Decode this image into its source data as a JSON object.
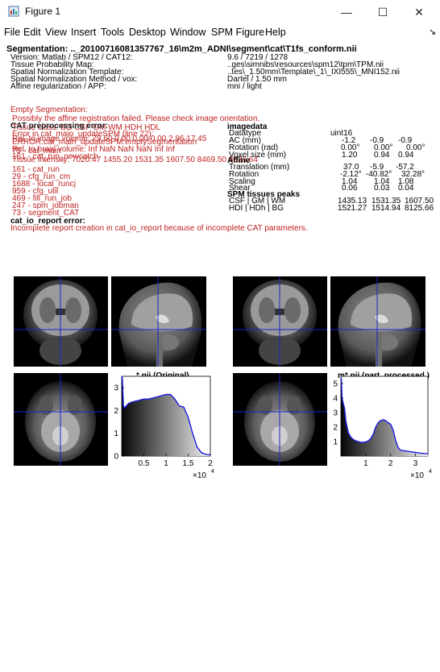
{
  "window": {
    "title": "Figure 1",
    "controls": {
      "minimize": "—",
      "maximize": "☐",
      "close": "✕"
    }
  },
  "menu": [
    "File",
    "Edit",
    "View",
    "Insert",
    "Tools",
    "Desktop",
    "Window",
    "SPM Figure",
    "Help"
  ],
  "menu_arrow": "↘",
  "report": {
    "segmentation": "Segmentation: .._20100716081357767_16\\m2m_ADNI\\segment\\cat\\T1fs_conform.nii",
    "left_labels": [
      "Version: Matlab / SPM12 / CAT12:",
      "Tissue Probability Map:",
      "Spatial Normalization Template:",
      "Spatial Normalization Method / vox:",
      "Affine regularization / APP:"
    ],
    "right_values": [
      "9.6 / 7219 / 1278",
      "..ges\\simnibs\\resources\\spm12\\tpm\\TPM.nii",
      "..tes\\_1.50mm\\Template\\_1\\_IXI555\\_MNI152.nii",
      "Dartel / 1.50 mm",
      "mni / light"
    ],
    "empty_seg_title": "Empty Segmentation:",
    "empty_seg_lines": [
      "Possibly the affine registration failed. Please check image orientation.",
      "Tissue class:   BG    CSF    GM    WM    HDH   HDL",
      "Rel. to image volume:   79.60   0.00   0.00   0.00   2.96   17.45",
      "Rel. to brain volume:   Inf   NaN   NaN   NaN   Inf   Inf",
      "Tissue intensity:   7020.47   1455.20   1531.35   1607.50   8469.50   8833.64"
    ],
    "cat_error_title": "CAT preprocessing error:",
    "cat_error_lines": [
      "Error in cat_main_updateSPM (line 22):",
      "  ERROR:cat_main_updateSPM:emptySegmentation",
      "  75 - cat_main",
      "  161 - cat_run_newcatch",
      "  161 - cat_run",
      "  29 - cfg_run_cm",
      "  1688 - local_runcj",
      "  959 - cfg_util",
      "  469 - fill_run_job",
      "  247 - spm_jobman",
      "  73 - segment_CAT"
    ],
    "imagedata_title": "imagedata",
    "imagedata_rows": [
      {
        "label": "Datatype",
        "v": [
          "uint16",
          "",
          ""
        ]
      },
      {
        "label": "AC (mm)",
        "v": [
          "-1.2",
          "-0.9",
          "-0.9"
        ]
      },
      {
        "label": "Rotation (rad)",
        "v": [
          "0.00°",
          "0.00°",
          "0.00°"
        ]
      },
      {
        "label": "Voxel size (mm)",
        "v": [
          "1.20",
          "0.94",
          "0.94"
        ]
      }
    ],
    "affine_title": "Affine",
    "affine_rows": [
      {
        "label": "Translation (mm)",
        "v": [
          "37.0",
          "-5.9",
          "-57.2"
        ]
      },
      {
        "label": "Rotation",
        "v": [
          "-2.12°",
          "-40.82°",
          "32.28°"
        ]
      },
      {
        "label": "Scaling",
        "v": [
          "1.04",
          "1.04",
          "1.08"
        ]
      },
      {
        "label": "Shear",
        "v": [
          "0.06",
          "0.03",
          "0.04"
        ]
      }
    ],
    "peaks_title": "SPM tissues peaks",
    "peaks_rows": [
      {
        "label": "CSF | GM | WM",
        "v": [
          "1435.13",
          "1531.35",
          "1607.50"
        ]
      },
      {
        "label": "HDI | HDh | BG",
        "v": [
          "1521.27",
          "1514.94",
          "8125.66"
        ]
      }
    ],
    "io_error_title": "cat_io_report error:",
    "io_error_line": "Incomplete report creation in cat_io_report because of incomplete CAT parameters."
  },
  "hist_left": {
    "title": "*.nii (Original)",
    "xticks": [
      "0.5",
      "1",
      "1.5",
      "2"
    ],
    "yticks": [
      "0",
      "1",
      "2",
      "3"
    ],
    "exponent_base": "×10",
    "exponent": "4"
  },
  "hist_right": {
    "title": "m*.nii (part. processed )",
    "xticks": [
      "1",
      "2",
      "3"
    ],
    "yticks": [
      "1",
      "2",
      "3",
      "4",
      "5"
    ],
    "exponent_base": "×10",
    "exponent": "4"
  },
  "chart_data": [
    {
      "type": "area",
      "title": "*.nii (Original)",
      "xlabel": "",
      "ylabel": "",
      "xlim": [
        0,
        20000
      ],
      "ylim": [
        0,
        3.5
      ],
      "x": [
        0,
        150,
        400,
        700,
        1000,
        1500,
        2000,
        3000,
        4000,
        5000,
        6000,
        7000,
        8000,
        9000,
        10000,
        11000,
        12000,
        13000,
        14000,
        15000,
        16000,
        17000,
        18000,
        19000,
        20000
      ],
      "y": [
        3.5,
        3.4,
        2.2,
        2.1,
        2.2,
        2.3,
        2.35,
        2.4,
        2.45,
        2.5,
        2.5,
        2.55,
        2.6,
        2.65,
        2.7,
        2.7,
        2.5,
        2.2,
        2.15,
        1.7,
        1.0,
        0.4,
        0.15,
        0.07,
        0.05
      ]
    },
    {
      "type": "area",
      "title": "m*.nii (part. processed )",
      "xlabel": "",
      "ylabel": "",
      "xlim": [
        0,
        35000
      ],
      "ylim": [
        0,
        5.5
      ],
      "x": [
        0,
        200,
        500,
        1000,
        1500,
        2000,
        3000,
        4000,
        5000,
        6000,
        7000,
        8000,
        9000,
        10000,
        11000,
        12000,
        13000,
        14000,
        15000,
        16000,
        17000,
        18000,
        19000,
        20000,
        21000,
        22000,
        23000,
        24000,
        26000,
        28000,
        30000,
        32000,
        35000
      ],
      "y": [
        5.4,
        5.3,
        4.0,
        3.6,
        3.3,
        2.4,
        1.6,
        1.3,
        1.15,
        1.05,
        1.0,
        0.95,
        0.95,
        0.98,
        1.05,
        1.2,
        1.5,
        2.0,
        2.3,
        2.45,
        2.5,
        2.45,
        2.3,
        2.2,
        1.8,
        1.1,
        0.6,
        0.4,
        0.35,
        0.3,
        0.25,
        0.2,
        0.15
      ]
    }
  ]
}
